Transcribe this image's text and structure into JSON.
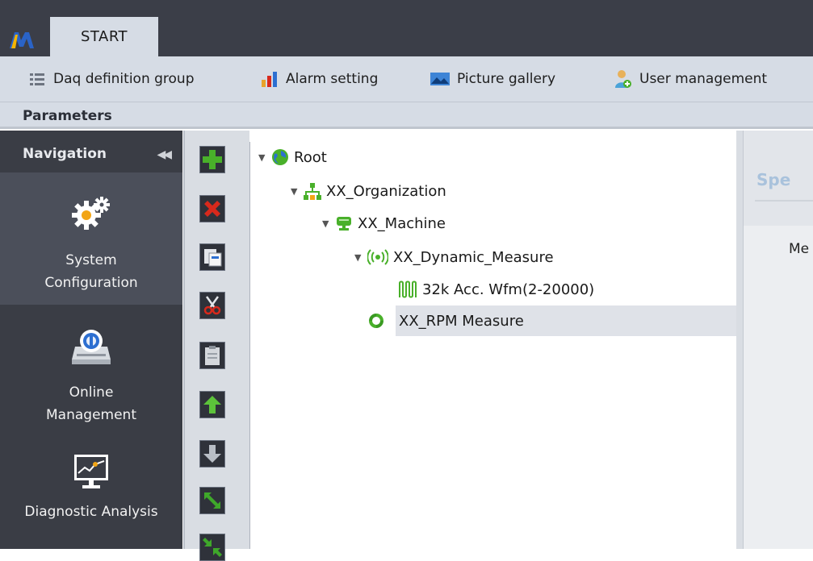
{
  "app": {
    "tab_label": "START"
  },
  "ribbon": {
    "items": [
      {
        "label": "Daq definition group",
        "icon": "list-icon"
      },
      {
        "label": "Alarm setting",
        "icon": "bar-chart-icon"
      },
      {
        "label": "Picture gallery",
        "icon": "picture-icon"
      },
      {
        "label": "User management",
        "icon": "user-add-icon"
      }
    ]
  },
  "parameters_label": "Parameters",
  "navigation": {
    "header": "Navigation",
    "collapse_glyph": "◀◀",
    "items": [
      {
        "line1": "System",
        "line2": "Configuration",
        "icon": "gears-icon",
        "active": true
      },
      {
        "line1": "Online",
        "line2": "Management",
        "icon": "online-device-icon",
        "active": false
      },
      {
        "line1": "Diagnostic Analysis",
        "line2": "",
        "icon": "monitor-chart-icon",
        "active": false
      }
    ]
  },
  "toolbar": {
    "buttons": [
      "add",
      "delete",
      "copy",
      "cut",
      "paste",
      "move-up",
      "move-down",
      "expand",
      "collapse"
    ]
  },
  "tree": {
    "nodes": [
      {
        "label": "Root",
        "icon": "globe-icon",
        "depth": 0,
        "expanded": true
      },
      {
        "label": "XX_Organization",
        "icon": "organization-icon",
        "depth": 1,
        "expanded": true
      },
      {
        "label": "XX_Machine",
        "icon": "machine-icon",
        "depth": 2,
        "expanded": true
      },
      {
        "label": "XX_Dynamic_Measure",
        "icon": "signal-icon",
        "depth": 3,
        "expanded": true
      },
      {
        "label": "32k Acc. Wfm(2-20000)",
        "icon": "waveform-icon",
        "depth": 4,
        "expanded": false
      },
      {
        "label": "XX_RPM Measure",
        "icon": "rpm-icon",
        "depth": 3,
        "expanded": false,
        "selected": true
      }
    ]
  },
  "right_pane": {
    "title": "Spe",
    "label": "Me"
  },
  "colors": {
    "dark_bg": "#3b3e48",
    "ribbon_bg": "#d6dce5",
    "accent_green": "#49b02a",
    "accent_red": "#d8291c"
  }
}
